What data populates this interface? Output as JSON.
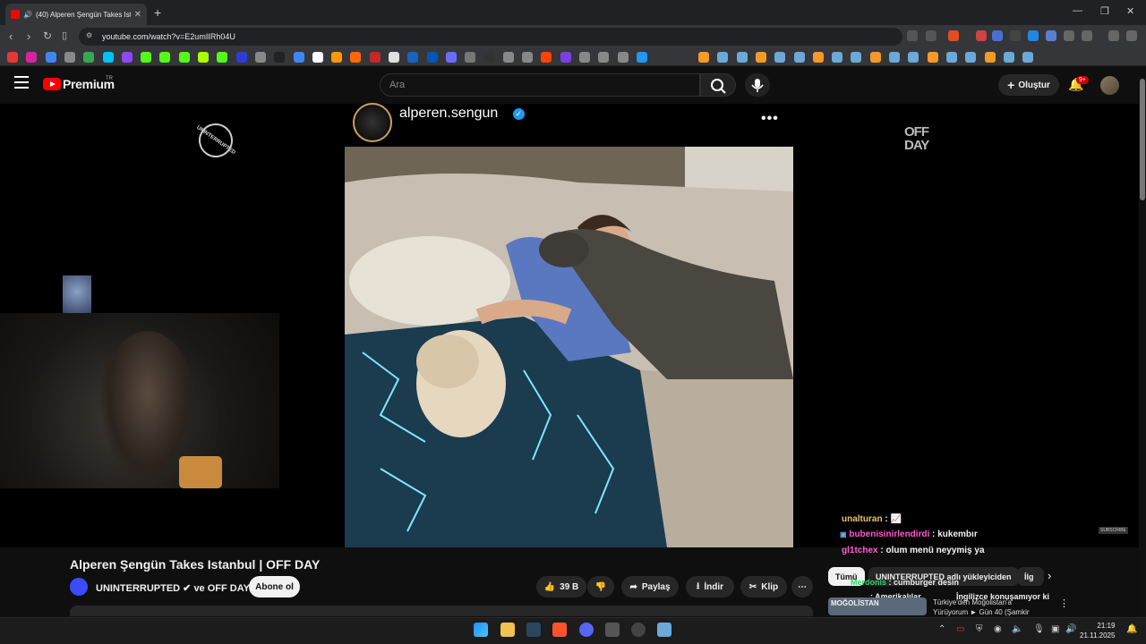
{
  "browser": {
    "tab_title": "(40) Alperen Şengün Takes Istanbul | OFF DAY",
    "new_tab": "+",
    "url": "youtube.com/watch?v=E2umIIRh04U",
    "window_controls": [
      "—",
      "❐",
      "✕"
    ]
  },
  "youtube": {
    "brand": "Premium",
    "region": "TR",
    "search_placeholder": "Ara",
    "create_label": "Oluştur",
    "notification_count": "9+"
  },
  "video": {
    "post_username": "alperen.sengun",
    "left_logo": "UNINTERRUPTED",
    "right_logo_line1": "OFF",
    "right_logo_line2": "DAY",
    "title": "Alperen Şengün Takes Istanbul | OFF DAY",
    "channel": "UNINTERRUPTED ✔ ve OFF DAY",
    "subscribe_label": "Abone ol",
    "like_count": "39 B",
    "share_label": "Paylaş",
    "download_label": "İndir",
    "clip_label": "Klip",
    "subscribe_tag": "SUBSCRIBE"
  },
  "chat": [
    {
      "user": "unalturan",
      "text": ": 📈",
      "color": "#e8c26b"
    },
    {
      "user": "bubenisinirlendirdi",
      "text": ": kukembır",
      "color": "#ff5bd0"
    },
    {
      "user": "gl1tchex",
      "text": ": olum menü neyymiş ya",
      "color": "#ff5bd0"
    },
    {
      "user": "Merdonis",
      "text": ": cumburger desin",
      "color": "#2bd46a"
    },
    {
      "user": "",
      "text": ": Amerikalılar",
      "color": "#5b8cff"
    },
    {
      "user": "",
      "text": "İngilizce konuşamıyor ki",
      "color": "#ffffff"
    }
  ],
  "chips": {
    "all": "Tümü",
    "uploader": "UNINTERRUPTED adlı yükleyiciden",
    "related": "İlg"
  },
  "recommendation": {
    "thumb_text": "MOĞOLİSTAN",
    "line1": "Türkiye'den Moğolistan'a",
    "line2": "Yürüyorum ► Gün 40 (Şamkir"
  },
  "taskbar": {
    "time": "21:19",
    "date": "21.11.2025"
  },
  "colors": {
    "youtube_red": "#ff0000",
    "verified_blue": "#1d9bf0",
    "background": "#0f0f0f"
  }
}
